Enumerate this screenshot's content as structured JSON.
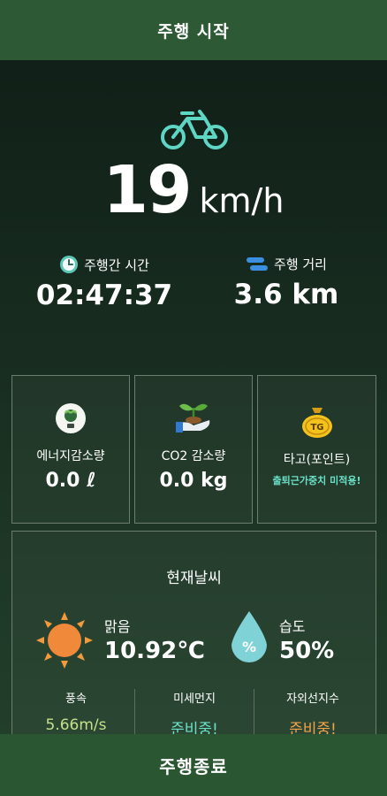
{
  "header": {
    "title": "주행 시작"
  },
  "speed": {
    "value": "19",
    "unit": "km/h"
  },
  "ride_time": {
    "label": "주행간 시간",
    "value": "02:47:37",
    "icon": "clock-icon"
  },
  "ride_distance": {
    "label": "주행 거리",
    "value": "3.6 km",
    "icon": "distance-icon"
  },
  "cards": {
    "energy": {
      "label": "에너지감소량",
      "value": "0.0 ℓ",
      "icon": "lightbulb-icon"
    },
    "co2": {
      "label": "CO2 감소량",
      "value": "0.0 kg",
      "icon": "sprout-hand-icon"
    },
    "tago": {
      "label": "타고(포인트)",
      "note": "출퇴근가중치 미적용!",
      "icon": "tg-coin-bag-icon",
      "coin_text": "TG"
    }
  },
  "weather": {
    "title": "현재날씨",
    "condition": {
      "label": "맑음",
      "value": "10.92℃"
    },
    "humidity": {
      "label": "습도",
      "value": "50%",
      "symbol": "%"
    },
    "wind": {
      "label": "풍속",
      "value": "5.66m/s"
    },
    "dust": {
      "label": "미세먼지",
      "value": "준비중!"
    },
    "uv": {
      "label": "자외선지수",
      "value": "준비중!"
    }
  },
  "footer": {
    "button": "주행종료"
  },
  "colors": {
    "header_bg": "#2d5a34",
    "accent_mint": "#5fd6c4",
    "sun_orange": "#f29a3c",
    "wind_value": "#c6e08a",
    "dust_value": "#6be0c8",
    "uv_value": "#f2a24a"
  }
}
